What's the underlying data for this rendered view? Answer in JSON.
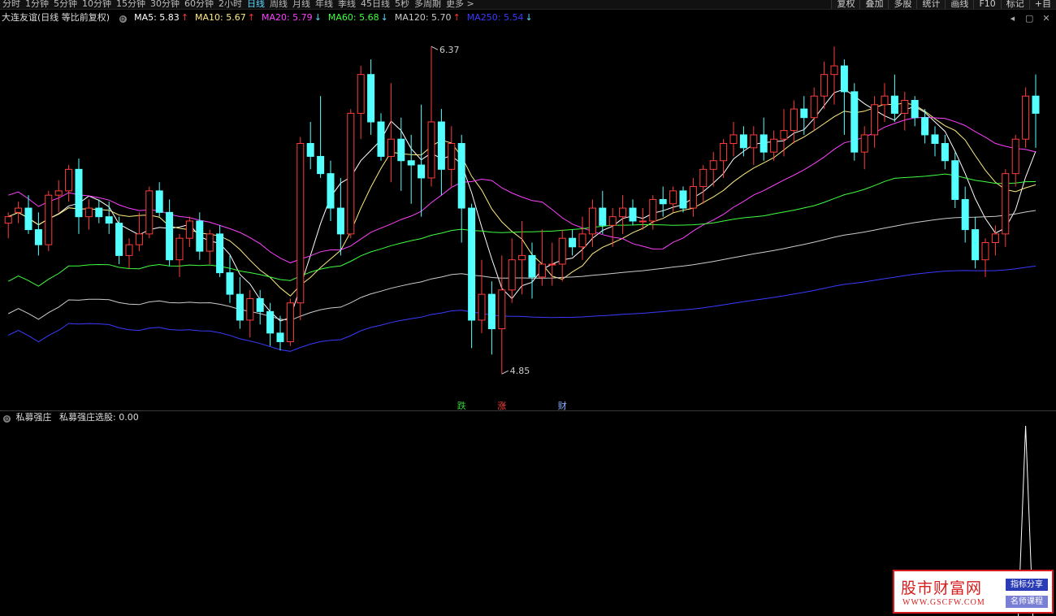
{
  "periods": [
    "分时",
    "1分钟",
    "5分钟",
    "10分钟",
    "15分钟",
    "30分钟",
    "60分钟",
    "2小时",
    "日线",
    "周线",
    "月线",
    "年线",
    "季线",
    "45日线",
    "5秒",
    "多周期"
  ],
  "active_period": "日线",
  "more_label": "更多 >",
  "tools": [
    "复权",
    "叠加",
    "多股",
    "统计",
    "画线",
    "F10",
    "标记",
    "+自"
  ],
  "stock_title": "大连友谊(日线 等比前复权)",
  "ma_items": [
    {
      "label": "MA5: 5.83",
      "arrow": "↑",
      "color": "#ffffff",
      "dir": "up"
    },
    {
      "label": "MA10: 5.67",
      "arrow": "↑",
      "color": "#ffeb80",
      "dir": "up"
    },
    {
      "label": "MA20: 5.79",
      "arrow": "↓",
      "color": "#ff40ff",
      "dir": "down"
    },
    {
      "label": "MA60: 5.68",
      "arrow": "↓",
      "color": "#40ff40",
      "dir": "down"
    },
    {
      "label": "MA120: 5.70",
      "arrow": "↑",
      "color": "#cccccc",
      "dir": "up"
    },
    {
      "label": "MA250: 5.54",
      "arrow": "↓",
      "color": "#3a3aff",
      "dir": "down"
    }
  ],
  "panel_icons": [
    "settings-icon",
    "arrow-left-icon",
    "maximize-icon",
    "close-icon"
  ],
  "chart_data": {
    "type": "candlestick",
    "price_range": [
      4.7,
      6.45
    ],
    "high_label": "6.37",
    "low_label": "4.85",
    "signals": [
      {
        "text": "跌",
        "color": "#30d030",
        "bar": 45
      },
      {
        "text": "涨",
        "color": "#ff4040",
        "bar": 49
      },
      {
        "text": "财",
        "color": "#8ab4ff",
        "bar": 55
      }
    ],
    "candles": [
      [
        5.55,
        5.6,
        5.48,
        5.58
      ],
      [
        5.6,
        5.65,
        5.55,
        5.62
      ],
      [
        5.62,
        5.68,
        5.5,
        5.52
      ],
      [
        5.52,
        5.6,
        5.4,
        5.45
      ],
      [
        5.45,
        5.7,
        5.42,
        5.68
      ],
      [
        5.68,
        5.75,
        5.6,
        5.7
      ],
      [
        5.7,
        5.82,
        5.65,
        5.8
      ],
      [
        5.8,
        5.85,
        5.5,
        5.58
      ],
      [
        5.58,
        5.66,
        5.52,
        5.62
      ],
      [
        5.62,
        5.66,
        5.55,
        5.58
      ],
      [
        5.58,
        5.65,
        5.5,
        5.55
      ],
      [
        5.55,
        5.58,
        5.36,
        5.4
      ],
      [
        5.4,
        5.48,
        5.34,
        5.45
      ],
      [
        5.45,
        5.6,
        5.42,
        5.5
      ],
      [
        5.5,
        5.72,
        5.48,
        5.7
      ],
      [
        5.7,
        5.74,
        5.58,
        5.6
      ],
      [
        5.6,
        5.66,
        5.35,
        5.38
      ],
      [
        5.38,
        5.5,
        5.3,
        5.48
      ],
      [
        5.48,
        5.58,
        5.44,
        5.56
      ],
      [
        5.56,
        5.6,
        5.38,
        5.42
      ],
      [
        5.42,
        5.52,
        5.36,
        5.5
      ],
      [
        5.5,
        5.54,
        5.3,
        5.32
      ],
      [
        5.32,
        5.4,
        5.18,
        5.22
      ],
      [
        5.22,
        5.3,
        5.06,
        5.1
      ],
      [
        5.1,
        5.24,
        5.02,
        5.2
      ],
      [
        5.2,
        5.24,
        5.08,
        5.14
      ],
      [
        5.14,
        5.18,
        4.98,
        5.04
      ],
      [
        5.04,
        5.12,
        4.96,
        5.0
      ],
      [
        5.0,
        5.2,
        4.98,
        5.18
      ],
      [
        5.18,
        5.95,
        5.1,
        5.92
      ],
      [
        5.92,
        6.02,
        5.8,
        5.86
      ],
      [
        5.86,
        6.14,
        5.76,
        5.78
      ],
      [
        5.78,
        5.84,
        5.56,
        5.62
      ],
      [
        5.62,
        5.76,
        5.4,
        5.5
      ],
      [
        5.5,
        6.08,
        5.48,
        6.06
      ],
      [
        6.06,
        6.28,
        5.94,
        6.24
      ],
      [
        6.24,
        6.31,
        5.96,
        6.02
      ],
      [
        6.02,
        6.06,
        5.84,
        5.86
      ],
      [
        5.86,
        6.2,
        5.74,
        5.94
      ],
      [
        5.94,
        6.04,
        5.7,
        5.84
      ],
      [
        5.84,
        5.96,
        5.64,
        5.82
      ],
      [
        5.82,
        6.1,
        5.58,
        5.76
      ],
      [
        5.76,
        6.37,
        5.72,
        6.02
      ],
      [
        6.02,
        6.08,
        5.68,
        5.8
      ],
      [
        5.8,
        6.0,
        5.72,
        5.92
      ],
      [
        5.92,
        5.96,
        5.46,
        5.62
      ],
      [
        5.62,
        5.64,
        4.97,
        5.1
      ],
      [
        5.1,
        5.38,
        5.04,
        5.22
      ],
      [
        5.22,
        5.28,
        4.94,
        5.06
      ],
      [
        5.06,
        5.4,
        4.85,
        5.24
      ],
      [
        5.24,
        5.48,
        5.18,
        5.38
      ],
      [
        5.38,
        5.56,
        5.22,
        5.4
      ],
      [
        5.4,
        5.46,
        5.2,
        5.3
      ],
      [
        5.3,
        5.52,
        5.26,
        5.36
      ],
      [
        5.36,
        5.46,
        5.26,
        5.36
      ],
      [
        5.36,
        5.52,
        5.28,
        5.48
      ],
      [
        5.48,
        5.52,
        5.4,
        5.44
      ],
      [
        5.44,
        5.58,
        5.38,
        5.5
      ],
      [
        5.5,
        5.66,
        5.44,
        5.62
      ],
      [
        5.62,
        5.7,
        5.5,
        5.54
      ],
      [
        5.54,
        5.62,
        5.44,
        5.58
      ],
      [
        5.58,
        5.68,
        5.5,
        5.62
      ],
      [
        5.62,
        5.66,
        5.54,
        5.56
      ],
      [
        5.56,
        5.62,
        5.52,
        5.56
      ],
      [
        5.56,
        5.68,
        5.52,
        5.66
      ],
      [
        5.66,
        5.72,
        5.58,
        5.64
      ],
      [
        5.64,
        5.72,
        5.6,
        5.7
      ],
      [
        5.7,
        5.72,
        5.6,
        5.62
      ],
      [
        5.62,
        5.76,
        5.58,
        5.72
      ],
      [
        5.72,
        5.82,
        5.64,
        5.8
      ],
      [
        5.8,
        5.88,
        5.72,
        5.84
      ],
      [
        5.84,
        5.94,
        5.76,
        5.92
      ],
      [
        5.92,
        6.02,
        5.86,
        5.96
      ],
      [
        5.96,
        6.0,
        5.86,
        5.9
      ],
      [
        5.9,
        6.0,
        5.82,
        5.96
      ],
      [
        5.96,
        6.04,
        5.84,
        5.88
      ],
      [
        5.88,
        5.98,
        5.84,
        5.94
      ],
      [
        5.94,
        6.08,
        5.86,
        5.98
      ],
      [
        5.98,
        6.12,
        5.92,
        6.08
      ],
      [
        6.08,
        6.14,
        5.96,
        6.04
      ],
      [
        6.04,
        6.18,
        5.98,
        6.14
      ],
      [
        6.14,
        6.3,
        6.08,
        6.24
      ],
      [
        6.24,
        6.37,
        6.1,
        6.28
      ],
      [
        6.28,
        6.31,
        5.96,
        6.16
      ],
      [
        6.16,
        6.2,
        5.84,
        5.88
      ],
      [
        5.88,
        6.0,
        5.8,
        5.96
      ],
      [
        5.96,
        6.14,
        5.9,
        6.1
      ],
      [
        6.1,
        6.2,
        6.02,
        6.14
      ],
      [
        6.14,
        6.24,
        6.02,
        6.06
      ],
      [
        6.06,
        6.16,
        5.98,
        6.12
      ],
      [
        6.12,
        6.14,
        6.0,
        6.04
      ],
      [
        6.04,
        6.08,
        5.92,
        5.96
      ],
      [
        5.96,
        6.0,
        5.86,
        5.92
      ],
      [
        5.92,
        5.96,
        5.8,
        5.84
      ],
      [
        5.84,
        5.88,
        5.62,
        5.66
      ],
      [
        5.66,
        5.72,
        5.46,
        5.52
      ],
      [
        5.52,
        5.58,
        5.34,
        5.38
      ],
      [
        5.38,
        5.48,
        5.3,
        5.46
      ],
      [
        5.46,
        5.54,
        5.4,
        5.5
      ],
      [
        5.5,
        5.8,
        5.44,
        5.78
      ],
      [
        5.78,
        5.96,
        5.72,
        5.94
      ],
      [
        5.94,
        6.18,
        5.9,
        6.14
      ],
      [
        6.14,
        6.24,
        5.9,
        6.06
      ]
    ]
  },
  "sub_title": "私募强庄",
  "sub_value_label": "私募强庄选股: 0.00",
  "sub_signal": {
    "bar": 101,
    "value": 1
  },
  "watermark": {
    "title": "股市财富网",
    "url": "WWW.GSCFW.COM",
    "tag1": "指标分享",
    "tag2": "名师课程"
  }
}
